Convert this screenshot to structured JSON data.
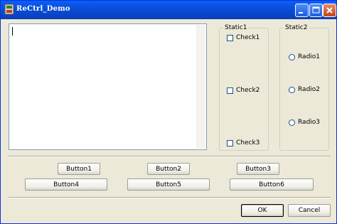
{
  "window": {
    "title": "ReCtrl_Demo"
  },
  "titlebar_buttons": [
    "minimize-icon",
    "maximize-icon",
    "close-icon"
  ],
  "group1": {
    "label": "Static1",
    "checks": [
      "Check1",
      "Check2",
      "Check3"
    ]
  },
  "group2": {
    "label": "Static2",
    "radios": [
      "Radio1",
      "Radio2",
      "Radio3"
    ]
  },
  "buttons": [
    "Button1",
    "Button2",
    "Button3",
    "Button4",
    "Button5",
    "Button6"
  ],
  "dialog": {
    "ok": "OK",
    "cancel": "Cancel"
  },
  "colors": {
    "titlebar": "#0a4ed8",
    "face": "#ece9d8",
    "close": "#c4441e"
  }
}
